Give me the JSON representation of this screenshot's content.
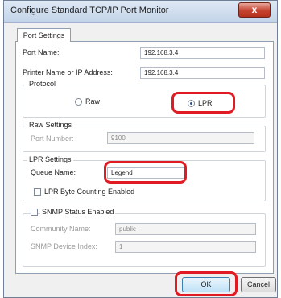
{
  "window": {
    "title": "Configure Standard TCP/IP Port Monitor",
    "close_glyph": "x"
  },
  "tab": {
    "label": "Port Settings"
  },
  "port_name": {
    "label": "Port Name:",
    "value": "192.168.3.4"
  },
  "printer_name": {
    "label": "Printer Name or IP Address:",
    "value": "192.168.3.4"
  },
  "protocol": {
    "title": "Protocol",
    "raw_label": "Raw",
    "lpr_label": "LPR",
    "selected": "LPR"
  },
  "raw_settings": {
    "title": "Raw Settings",
    "port_number_label": "Port Number:",
    "port_number_value": "9100"
  },
  "lpr_settings": {
    "title": "LPR Settings",
    "queue_name_label": "Queue Name:",
    "queue_name_value": "Legend",
    "byte_counting_label": "LPR Byte Counting Enabled"
  },
  "snmp": {
    "enabled_label": "SNMP Status Enabled",
    "community_label": "Community Name:",
    "community_value": "public",
    "device_index_label": "SNMP Device Index:",
    "device_index_value": "1"
  },
  "buttons": {
    "ok": "OK",
    "cancel": "Cancel"
  },
  "colors": {
    "highlight": "#e01b24",
    "title_bar": "#c3d4e8"
  }
}
